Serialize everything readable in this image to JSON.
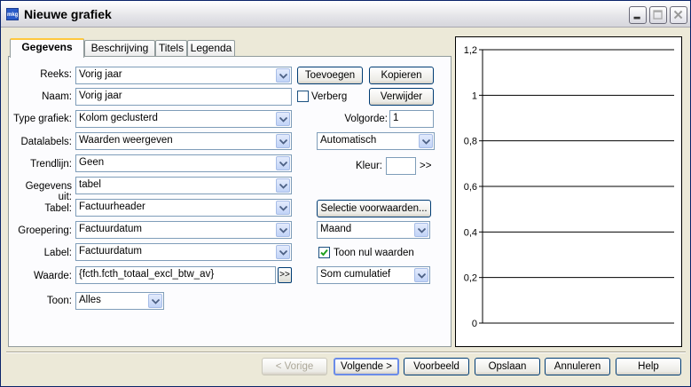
{
  "window": {
    "title": "Nieuwe grafiek",
    "app_icon_text": "mkg"
  },
  "tabs": [
    {
      "label": "Gegevens",
      "active": true
    },
    {
      "label": "Beschrijving",
      "active": false
    },
    {
      "label": "Titels",
      "active": false
    },
    {
      "label": "Legenda",
      "active": false
    }
  ],
  "form": {
    "reeks": {
      "label": "Reeks:",
      "value": "Vorig jaar"
    },
    "naam": {
      "label": "Naam:",
      "value": "Vorig jaar"
    },
    "type": {
      "label": "Type grafiek:",
      "value": "Kolom geclusterd"
    },
    "datalabels": {
      "label": "Datalabels:",
      "value": "Waarden weergeven"
    },
    "trendlijn": {
      "label": "Trendlijn:",
      "value": "Geen"
    },
    "gegevens_uit": {
      "label": "Gegevens uit:",
      "value": "tabel"
    },
    "tabel": {
      "label": "Tabel:",
      "value": "Factuurheader"
    },
    "groepering": {
      "label": "Groepering:",
      "value": "Factuurdatum"
    },
    "label_field": {
      "label": "Label:",
      "value": "Factuurdatum"
    },
    "waarde": {
      "label": "Waarde:",
      "value": "{fcth.fcth_totaal_excl_btw_av}"
    },
    "toon": {
      "label": "Toon:",
      "value": "Alles"
    },
    "verberg": {
      "label": "Verberg",
      "checked": false
    },
    "volgorde": {
      "label": "Volgorde:",
      "value": "1"
    },
    "datalabel_position": {
      "value": "Automatisch"
    },
    "kleur": {
      "label": "Kleur:",
      "more": ">>"
    },
    "groepering_interval": {
      "value": "Maand"
    },
    "toon_nul": {
      "label": "Toon nul waarden",
      "checked": true
    },
    "aggregatie": {
      "value": "Som cumulatief"
    },
    "waarde_more": ">>"
  },
  "buttons": {
    "toevoegen": "Toevoegen",
    "kopieren": "Kopieren",
    "verwijder": "Verwijder",
    "selectie": "Selectie voorwaarden...",
    "vorige": "< Vorige",
    "volgende": "Volgende >",
    "voorbeeld": "Voorbeeld",
    "opslaan": "Opslaan",
    "annuleren": "Annuleren",
    "help": "Help"
  },
  "chart_data": {
    "type": "bar",
    "categories": [],
    "series": [],
    "ylim": [
      0,
      1.2
    ],
    "yticks": [
      "0",
      "0,2",
      "0,4",
      "0,6",
      "0,8",
      "1",
      "1,2"
    ],
    "grid": true,
    "title": "",
    "xlabel": "",
    "ylabel": ""
  },
  "colors": {
    "accent": "#0a246a",
    "tab_highlight": "#ffc83c"
  }
}
